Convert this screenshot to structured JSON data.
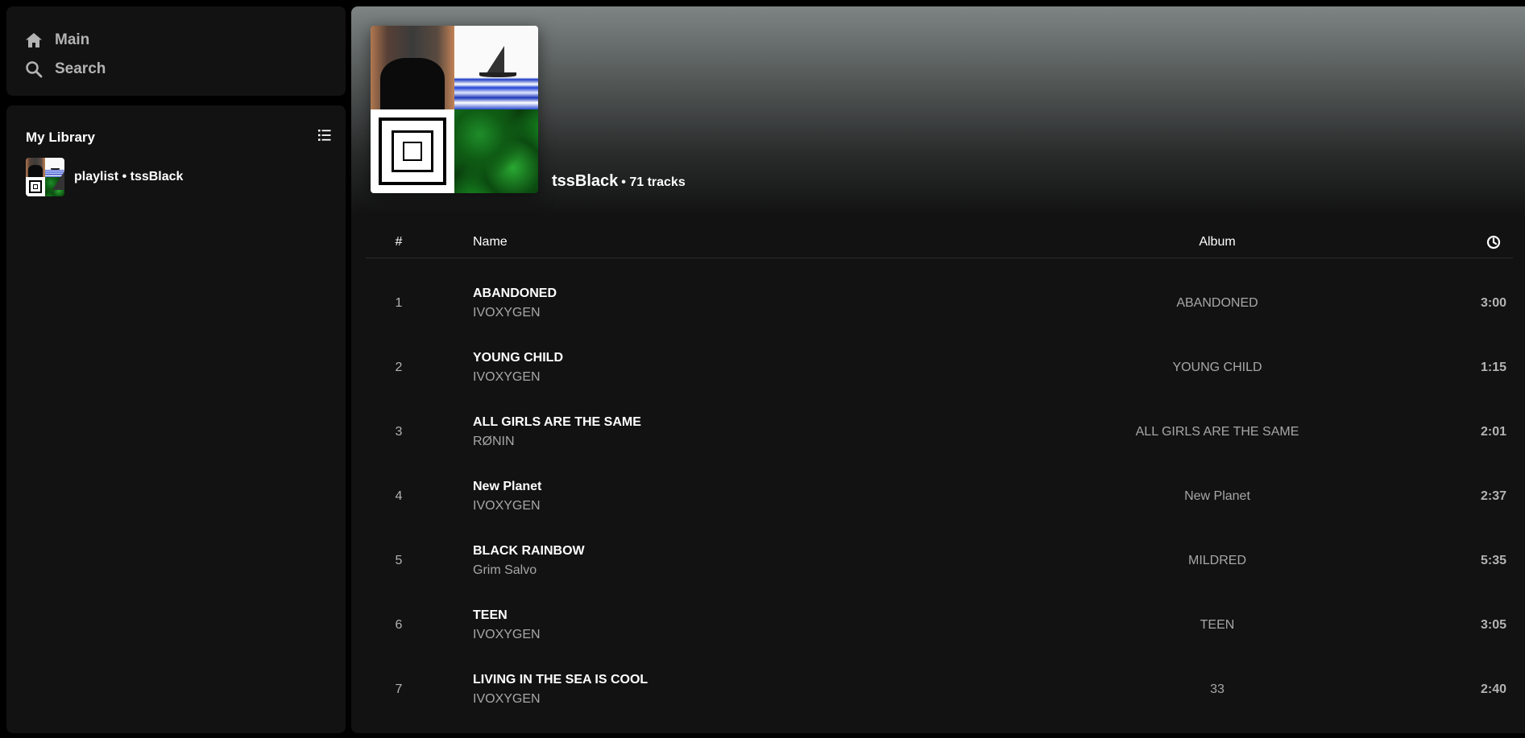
{
  "nav": {
    "main_label": "Main",
    "search_label": "Search"
  },
  "library": {
    "title": "My Library",
    "items": [
      {
        "label": "playlist • tssBlack"
      }
    ]
  },
  "playlist": {
    "name": "tssBlack",
    "meta": "• 71 tracks"
  },
  "table": {
    "headers": {
      "number": "#",
      "name": "Name",
      "album": "Album",
      "duration_icon": "clock-icon"
    },
    "tracks": [
      {
        "number": "1",
        "title": "ABANDONED",
        "artist": "IVOXYGEN",
        "album": "ABANDONED",
        "duration": "3:00"
      },
      {
        "number": "2",
        "title": "YOUNG CHILD",
        "artist": "IVOXYGEN",
        "album": "YOUNG CHILD",
        "duration": "1:15"
      },
      {
        "number": "3",
        "title": "ALL GIRLS ARE THE SAME",
        "artist": "RØNIN",
        "album": "ALL GIRLS ARE THE SAME",
        "duration": "2:01"
      },
      {
        "number": "4",
        "title": "New Planet",
        "artist": "IVOXYGEN",
        "album": "New Planet",
        "duration": "2:37"
      },
      {
        "number": "5",
        "title": "BLACK RAINBOW",
        "artist": "Grim Salvo",
        "album": "MILDRED",
        "duration": "5:35"
      },
      {
        "number": "6",
        "title": "TEEN",
        "artist": "IVOXYGEN",
        "album": "TEEN",
        "duration": "3:05"
      },
      {
        "number": "7",
        "title": "LIVING IN THE SEA IS COOL",
        "artist": "IVOXYGEN",
        "album": "33",
        "duration": "2:40"
      }
    ]
  },
  "colors": {
    "background": "#121212",
    "text_primary": "#ffffff",
    "text_secondary": "#a7a7a7"
  }
}
